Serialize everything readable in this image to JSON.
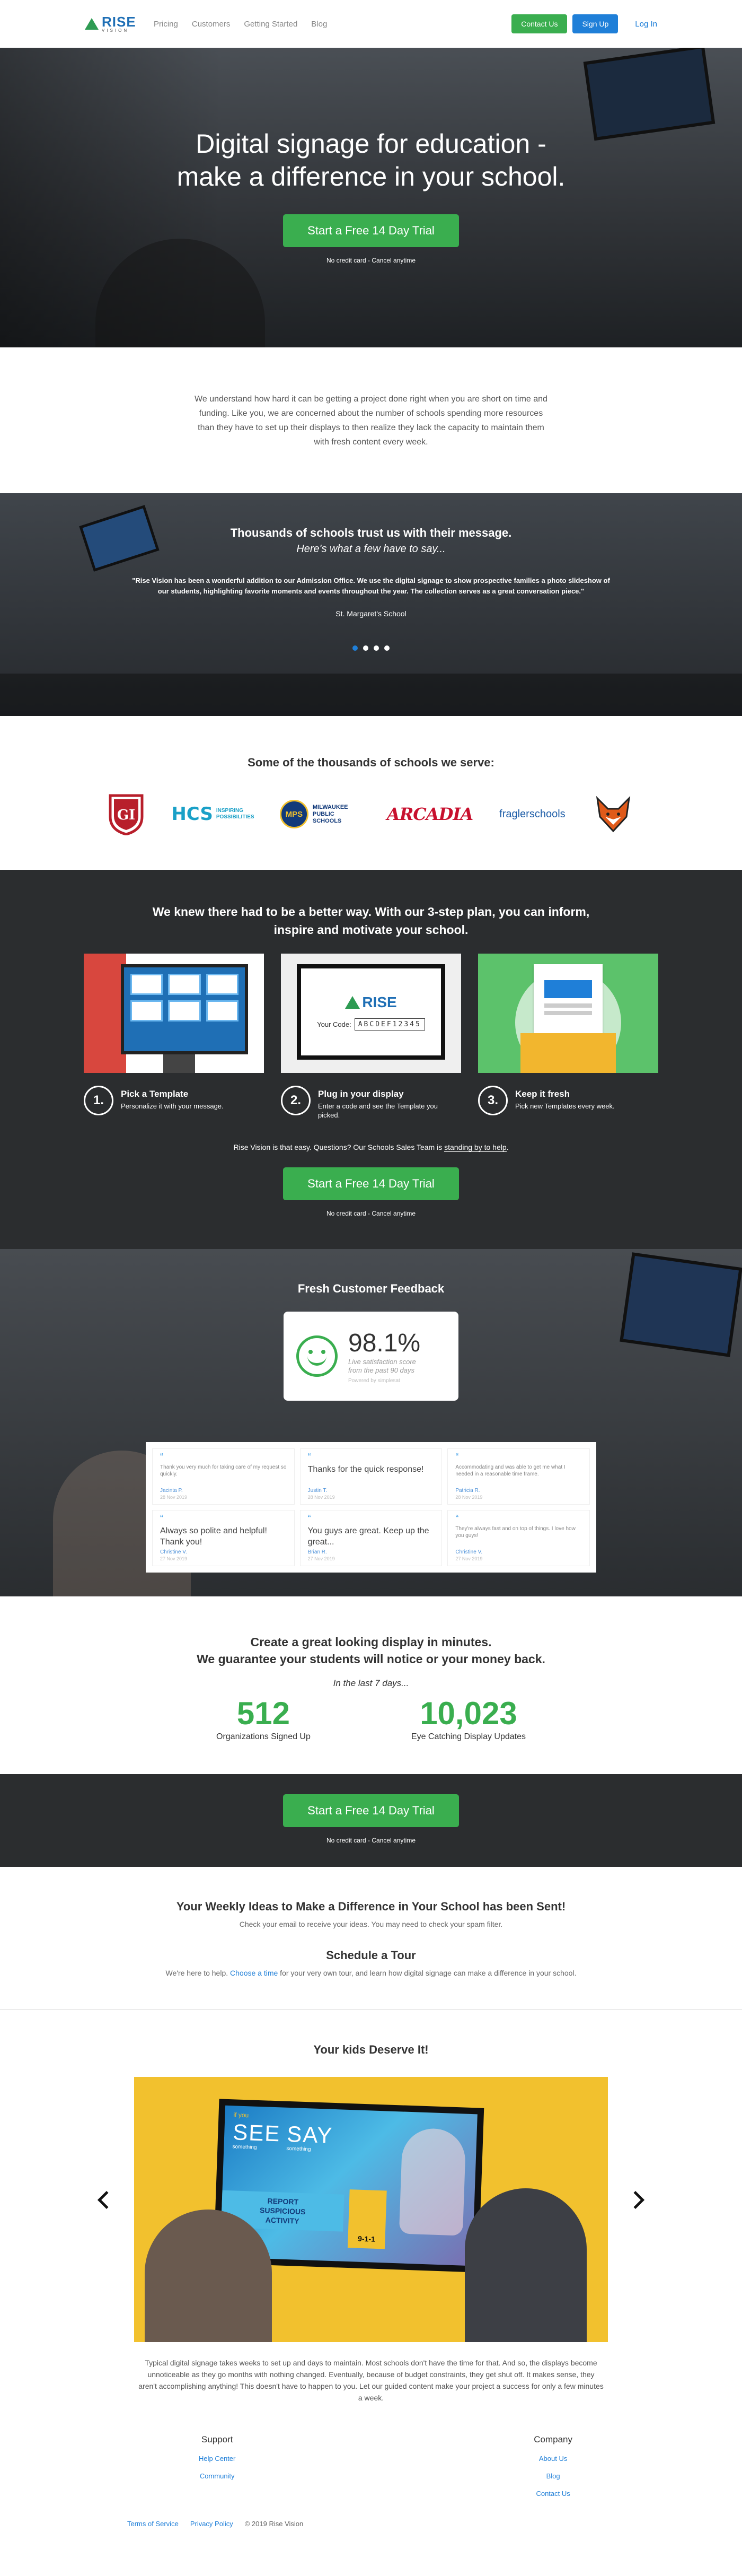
{
  "nav": {
    "logo_big": "RISE",
    "logo_small": "VISION",
    "links": [
      "Pricing",
      "Customers",
      "Getting Started",
      "Blog"
    ],
    "contact": "Contact Us",
    "signup": "Sign Up",
    "login": "Log In"
  },
  "hero": {
    "title_line1": "Digital signage for education -",
    "title_line2": "make a difference in your school.",
    "cta": "Start a Free 14 Day Trial",
    "note": "No credit card - Cancel anytime"
  },
  "intro": {
    "text": "We understand how hard it can be getting a project done right when you are short on time and funding. Like you, we are concerned about the number of schools spending more resources than they have to set up their displays to then realize they lack the capacity to maintain them with fresh content every week."
  },
  "testimonial": {
    "title": "Thousands of schools trust us with their message.",
    "subtitle": "Here's what a few have to say...",
    "quote": "\"Rise Vision has been a wonderful addition to our Admission Office. We use the digital signage to show prospective families a photo slideshow of our students, highlighting favorite moments and events throughout the year. The collection serves as a great conversation piece.\"",
    "author": "St. Margaret's School"
  },
  "schools": {
    "title": "Some of the thousands of schools we serve:",
    "logos": [
      {
        "text": "GI",
        "color": "#b81f2b"
      },
      {
        "text": "HCS",
        "sub": "INSPIRING POSSIBILITIES",
        "color": "#1aa0c7"
      },
      {
        "text": "MPS",
        "sub": "MILWAUKEE PUBLIC SCHOOLS",
        "color": "#123a7a"
      },
      {
        "text": "ARCADIA",
        "color": "#c8102e"
      },
      {
        "text": "fraglerschools",
        "color": "#1f5ea8"
      },
      {
        "text": "fox-icon",
        "color": "#e05a1a"
      }
    ]
  },
  "steps": {
    "title_line1": "We knew there had to be a better way. With our 3-step plan, you can inform,",
    "title_line2": "inspire and motivate your school.",
    "code_label": "Your Code:",
    "code_value": "ABCDEF12345",
    "items": [
      {
        "num": "1.",
        "title": "Pick a Template",
        "desc": "Personalize it with your message."
      },
      {
        "num": "2.",
        "title": "Plug in your display",
        "desc": "Enter a code and see the Template you picked."
      },
      {
        "num": "3.",
        "title": "Keep it fresh",
        "desc": "Pick new Templates every week."
      }
    ],
    "easy_prefix": "Rise Vision is that easy. Questions? Our Schools Sales Team is ",
    "easy_link": "standing by to help",
    "easy_suffix": ".",
    "cta": "Start a Free 14 Day Trial",
    "note": "No credit card - Cancel anytime"
  },
  "feedback": {
    "title": "Fresh Customer Feedback",
    "score": "98.1%",
    "score_sub1": "Live satisfaction score",
    "score_sub2": "from the past 90 days",
    "powered": "Powered by simplesat",
    "cards": [
      {
        "text": "Thank you very much for taking care of my request so quickly.",
        "small": true,
        "who": "Jacinta P.",
        "when": "28 Nov 2019"
      },
      {
        "text": "Thanks for the quick response!",
        "small": false,
        "who": "Justin T.",
        "when": "28 Nov 2019"
      },
      {
        "text": "Accommodating and was able to get me what I needed in a reasonable time frame.",
        "small": true,
        "who": "Patricia R.",
        "when": "28 Nov 2019"
      },
      {
        "text": "Always so polite and helpful! Thank you!",
        "small": false,
        "who": "Christine V.",
        "when": "27 Nov 2019"
      },
      {
        "text": "You guys are great. Keep up the great...",
        "small": false,
        "who": "Brian R.",
        "when": "27 Nov 2019"
      },
      {
        "text": "They're always fast and on top of things. I love how you guys!",
        "small": true,
        "who": "Christine V.",
        "when": "27 Nov 2019"
      }
    ]
  },
  "guarantee": {
    "line1": "Create a great looking display in minutes.",
    "line2": "We guarantee your students will notice or your money back.",
    "last": "In the last 7 days...",
    "stat1_n": "512",
    "stat1_l": "Organizations Signed Up",
    "stat2_n": "10,023",
    "stat2_l": "Eye Catching Display Updates"
  },
  "cta_band": {
    "cta": "Start a Free 14 Day Trial",
    "note": "No credit card - Cancel anytime"
  },
  "sent": {
    "title": "Your Weekly Ideas to Make a Difference in Your School has been Sent!",
    "text": "Check your email to receive your ideas. You may need to check your spam filter.",
    "tour_title": "Schedule a Tour",
    "tour_prefix": "We're here to help. ",
    "tour_link": "Choose a time",
    "tour_suffix": " for your very own tour, and learn how digital signage can make a difference in your school."
  },
  "kids": {
    "title": "Your kids Deserve It!",
    "screen_small": "if you",
    "screen_see": "SEE",
    "screen_say": "SAY",
    "screen_something1": "something",
    "screen_something2": "something",
    "screen_report1": "REPORT",
    "screen_report2": "SUSPICIOUS",
    "screen_report3": "ACTIVITY",
    "screen_phone": "9-1-1",
    "text": "Typical digital signage takes weeks to set up and days to maintain. Most schools don't have the time for that. And so, the displays become unnoticeable as they go months with nothing changed. Eventually, because of budget constraints, they get shut off. It makes sense, they aren't accomplishing anything! This doesn't have to happen to you. Let our guided content make your project a success for only a few minutes a week."
  },
  "footer": {
    "support_h": "Support",
    "support_links": [
      "Help Center",
      "Community"
    ],
    "company_h": "Company",
    "company_links": [
      "About Us",
      "Blog",
      "Contact Us"
    ],
    "terms": "Terms of Service",
    "privacy": "Privacy Policy",
    "copyright": "© 2019 Rise Vision"
  },
  "colors": {
    "green": "#3aae4f",
    "blue": "#1f7fd8",
    "dark": "#2b2d2f"
  }
}
